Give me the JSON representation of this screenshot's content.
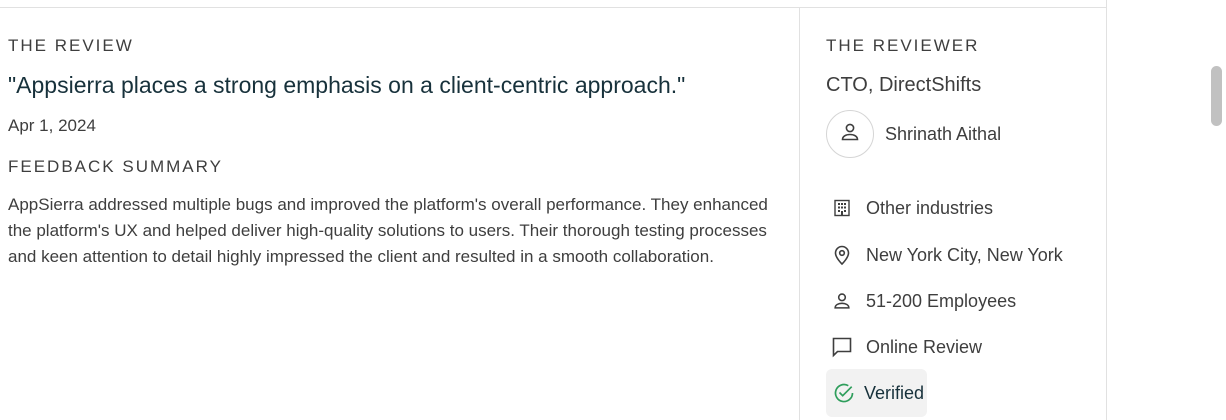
{
  "review": {
    "heading": "THE REVIEW",
    "quote": "\"Appsierra places a strong emphasis on a client-centric approach.\"",
    "date": "Apr 1, 2024",
    "summary_heading": "FEEDBACK SUMMARY",
    "summary": "AppSierra addressed multiple bugs and improved the platform's overall performance. They enhanced the platform's UX and helped deliver high-quality solutions to users. Their thorough testing processes and keen attention to detail highly impressed the client and resulted in a smooth collaboration."
  },
  "reviewer": {
    "heading": "THE REVIEWER",
    "title": "CTO, DirectShifts",
    "name": "Shrinath Aithal",
    "avatar_icon": "person-icon",
    "details": [
      {
        "icon": "building-icon",
        "text": "Other industries"
      },
      {
        "icon": "location-pin-icon",
        "text": "New York City, New York"
      },
      {
        "icon": "person-icon",
        "text": "51-200 Employees"
      },
      {
        "icon": "chat-bubble-icon",
        "text": "Online Review"
      }
    ],
    "verified": {
      "icon": "check-circle-icon",
      "text": "Verified",
      "color": "#2f9e5c"
    }
  }
}
